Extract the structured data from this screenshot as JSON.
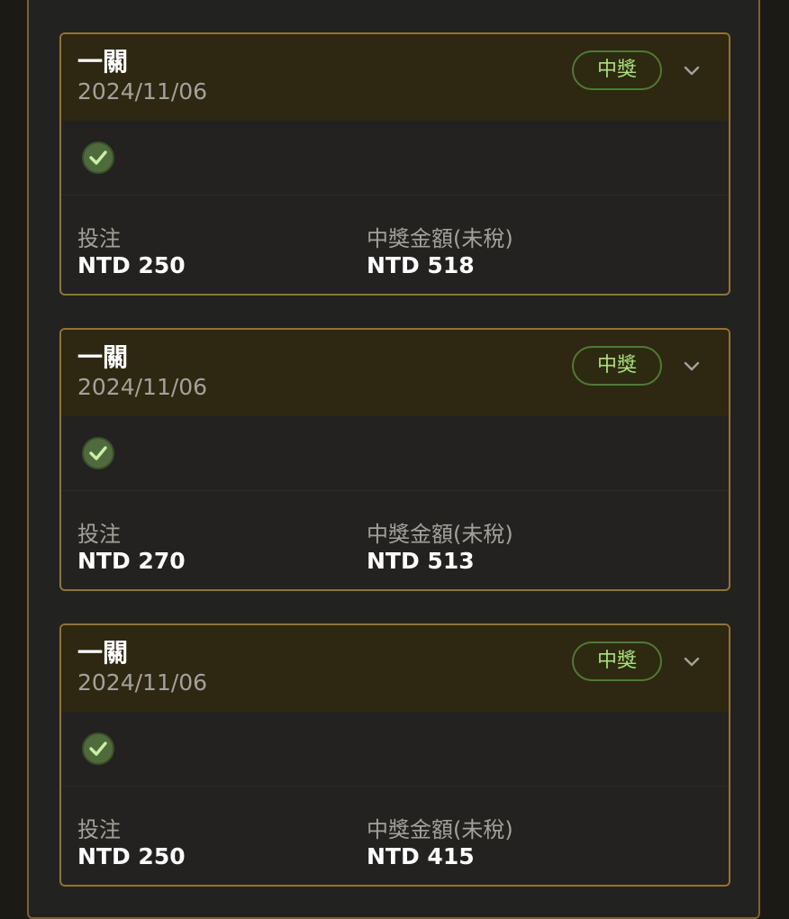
{
  "colors": {
    "card_border": "#8f7436",
    "header_bg": "#2e2711",
    "badge_text": "#a8e07a",
    "badge_border": "#4f7a34",
    "check_fill": "#4f6b3c"
  },
  "icons": {
    "check": "check-circle-icon",
    "expand": "chevron-down-icon"
  },
  "bets": [
    {
      "title": "一關",
      "date": "2024/11/06",
      "status": "中獎",
      "stake_label": "投注",
      "stake_value": "NTD 250",
      "payout_label": "中獎金額(未稅)",
      "payout_value": "NTD 518"
    },
    {
      "title": "一關",
      "date": "2024/11/06",
      "status": "中獎",
      "stake_label": "投注",
      "stake_value": "NTD 270",
      "payout_label": "中獎金額(未稅)",
      "payout_value": "NTD 513"
    },
    {
      "title": "一關",
      "date": "2024/11/06",
      "status": "中獎",
      "stake_label": "投注",
      "stake_value": "NTD 250",
      "payout_label": "中獎金額(未稅)",
      "payout_value": "NTD 415"
    }
  ]
}
